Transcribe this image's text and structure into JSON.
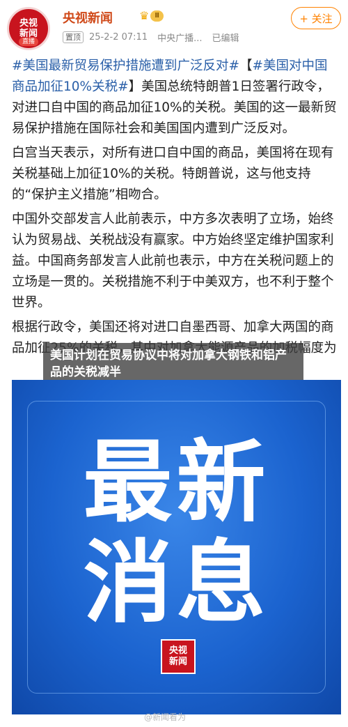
{
  "header": {
    "avatar_line1": "央视",
    "avatar_line2": "新闻",
    "avatar_live": "直播",
    "author": "央视新闻",
    "vip_level": "Ⅱ",
    "follow_label": "+ 关注",
    "pin_label": "置顶",
    "time": "25-2-2 07:11",
    "source": "中央广播...",
    "edited": "已编辑"
  },
  "post": {
    "p1_topic1": "#美国最新贸易保护措施遭到广泛反对#",
    "p1_bracket_open": "【",
    "p1_topic2": "#美国对中国商品加征10%关税#",
    "p1_rest": "】美国总统特朗普1日签署行政令，对进口自中国的商品加征10%的关税。美国的这一最新贸易保护措施在国际社会和美国国内遭到广泛反对。",
    "p2": "白宫当天表示，对所有进口自中国的商品，美国将在现有关税基础上加征10%的关税。特朗普说，这与他支持的“保护主义措施”相吻合。",
    "p3": "中国外交部发言人此前表示，中方多次表明了立场，始终认为贸易战、关税战没有赢家。中方始终坚定维护国家利益。中国商务部发言人此前也表示，中方在关税问题上的立场是一贯的。关税措施不利于中美双方，也不利于整个世界。",
    "p4": "根据行政令，美国还将对进口自墨西哥、加拿大两国的商品加征25%的关税，其中对加拿大能源产品的加税幅度为"
  },
  "overlay_caption": "美国计划在贸易协议中将对加拿大钢铁和铝产品的关税减半",
  "banner": {
    "line1": "最新",
    "line2": "消息",
    "logo_line1": "央视",
    "logo_line2": "新闻"
  },
  "watermark": "@新闻看为",
  "colors": {
    "author": "#d04a1a",
    "topic": "#2a5fa8",
    "follow": "#ff8200",
    "banner": "#1b63cf"
  }
}
